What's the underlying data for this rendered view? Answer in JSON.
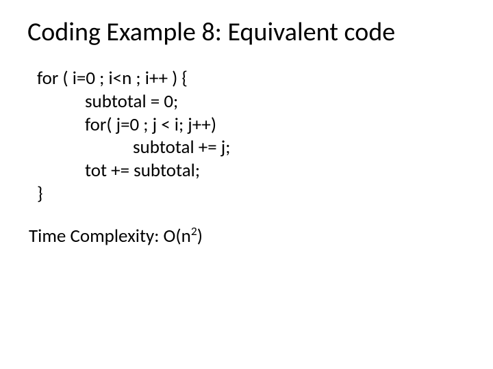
{
  "title": "Coding Example 8: Equivalent code",
  "code": {
    "l1": "for ( i=0 ; i<n ; i++ ) {",
    "l2": "subtotal = 0;",
    "l3": "for( j=0 ; j < i; j++)",
    "l4": "subtotal += j;",
    "l5": "tot += subtotal;",
    "l6": "}"
  },
  "complexity": {
    "prefix": "Time Complexity: O(n",
    "exp": "2",
    "suffix": ")"
  }
}
